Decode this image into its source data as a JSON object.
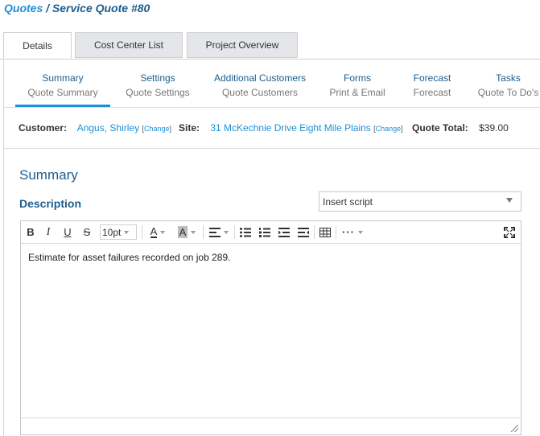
{
  "breadcrumb": {
    "root": "Quotes",
    "separator": "/",
    "current": "Service Quote #80"
  },
  "tabs": [
    {
      "label": "Details",
      "active": true
    },
    {
      "label": "Cost Center List",
      "active": false
    },
    {
      "label": "Project Overview",
      "active": false
    }
  ],
  "subnav": [
    {
      "title": "Summary",
      "subtitle": "Quote Summary",
      "active": true
    },
    {
      "title": "Settings",
      "subtitle": "Quote Settings"
    },
    {
      "title": "Additional Customers",
      "subtitle": "Quote Customers"
    },
    {
      "title": "Forms",
      "subtitle": "Print & Email"
    },
    {
      "title": "Forecast",
      "subtitle": "Forecast"
    },
    {
      "title": "Tasks",
      "subtitle": "Quote To Do's"
    }
  ],
  "info": {
    "customer_label": "Customer:",
    "customer_value": "Angus, Shirley",
    "site_label": "Site:",
    "site_value": "31 McKechnie Drive Eight Mile Plains",
    "change_label": "Change",
    "total_label": "Quote Total:",
    "total_value": "$39.00"
  },
  "summary": {
    "heading": "Summary",
    "description_label": "Description",
    "script_select": "Insert script"
  },
  "editor": {
    "font_size": "10pt",
    "text": "Estimate for asset failures recorded on job 289.",
    "icons": [
      "bold-icon",
      "italic-icon",
      "underline-icon",
      "strikethrough-icon",
      "font-color-icon",
      "highlight-color-icon",
      "align-icon",
      "bullet-list-icon",
      "numbered-list-icon",
      "indent-icon",
      "outdent-icon",
      "table-icon",
      "more-icon",
      "fullscreen-icon"
    ]
  },
  "colors": {
    "link": "#1e90d6",
    "heading": "#1b5e8e",
    "accent": "#1e90d6",
    "tab_inactive": "#e4e6ea"
  }
}
